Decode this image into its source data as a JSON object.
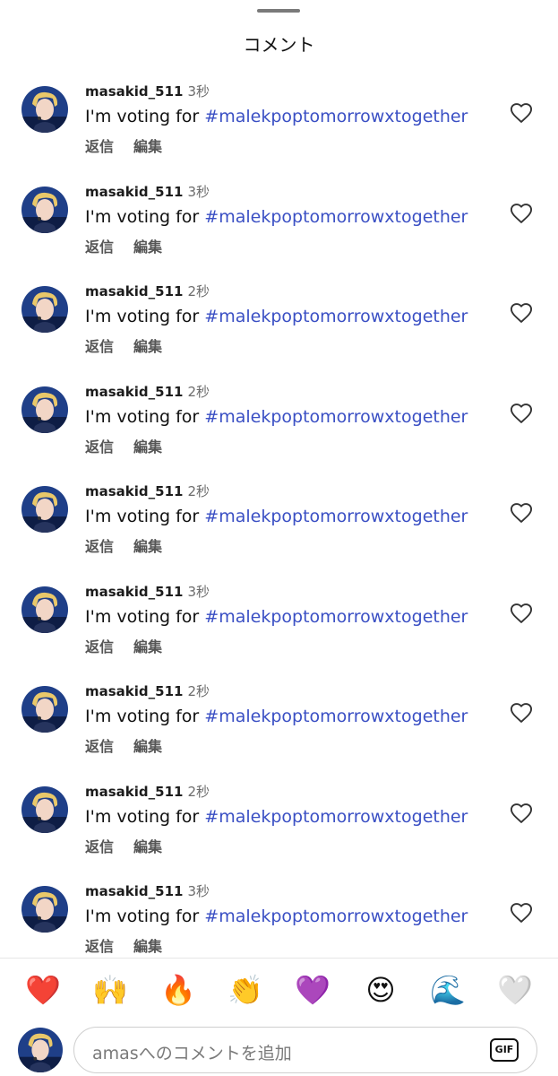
{
  "sheet": {
    "title": "コメント"
  },
  "comments": [
    {
      "username": "masakid_511",
      "time": "3秒",
      "text_prefix": "I'm voting for ",
      "hashtag": "#malekpoptomorrowxtogether",
      "reply_label": "返信",
      "edit_label": "編集"
    },
    {
      "username": "masakid_511",
      "time": "3秒",
      "text_prefix": "I'm voting for ",
      "hashtag": "#malekpoptomorrowxtogether",
      "reply_label": "返信",
      "edit_label": "編集"
    },
    {
      "username": "masakid_511",
      "time": "2秒",
      "text_prefix": "I'm voting for ",
      "hashtag": "#malekpoptomorrowxtogether",
      "reply_label": "返信",
      "edit_label": "編集"
    },
    {
      "username": "masakid_511",
      "time": "2秒",
      "text_prefix": "I'm voting for ",
      "hashtag": "#malekpoptomorrowxtogether",
      "reply_label": "返信",
      "edit_label": "編集"
    },
    {
      "username": "masakid_511",
      "time": "2秒",
      "text_prefix": "I'm voting for ",
      "hashtag": "#malekpoptomorrowxtogether",
      "reply_label": "返信",
      "edit_label": "編集"
    },
    {
      "username": "masakid_511",
      "time": "3秒",
      "text_prefix": "I'm voting for ",
      "hashtag": "#malekpoptomorrowxtogether",
      "reply_label": "返信",
      "edit_label": "編集"
    },
    {
      "username": "masakid_511",
      "time": "2秒",
      "text_prefix": "I'm voting for ",
      "hashtag": "#malekpoptomorrowxtogether",
      "reply_label": "返信",
      "edit_label": "編集"
    },
    {
      "username": "masakid_511",
      "time": "2秒",
      "text_prefix": "I'm voting for ",
      "hashtag": "#malekpoptomorrowxtogether",
      "reply_label": "返信",
      "edit_label": "編集"
    },
    {
      "username": "masakid_511",
      "time": "3秒",
      "text_prefix": "I'm voting for ",
      "hashtag": "#malekpoptomorrowxtogether",
      "reply_label": "返信",
      "edit_label": "編集"
    }
  ],
  "icons": {
    "like": "heart-outline-icon",
    "gif": "gif-icon"
  },
  "emoji_bar": [
    {
      "name": "red-heart",
      "glyph": "❤️"
    },
    {
      "name": "raising-hands",
      "glyph": "🙌"
    },
    {
      "name": "fire",
      "glyph": "🔥"
    },
    {
      "name": "clapping-hands",
      "glyph": "👏"
    },
    {
      "name": "purple-heart",
      "glyph": "💜"
    },
    {
      "name": "heart-eyes",
      "glyph": "😍"
    },
    {
      "name": "water-wave",
      "glyph": "🌊"
    },
    {
      "name": "white-heart",
      "glyph": "🤍"
    }
  ],
  "composer": {
    "placeholder": "amasへのコメントを追加",
    "gif_label": "GIF"
  },
  "colors": {
    "hashtag": "#3a4fc4",
    "secondary_text": "#6b6b6b"
  }
}
